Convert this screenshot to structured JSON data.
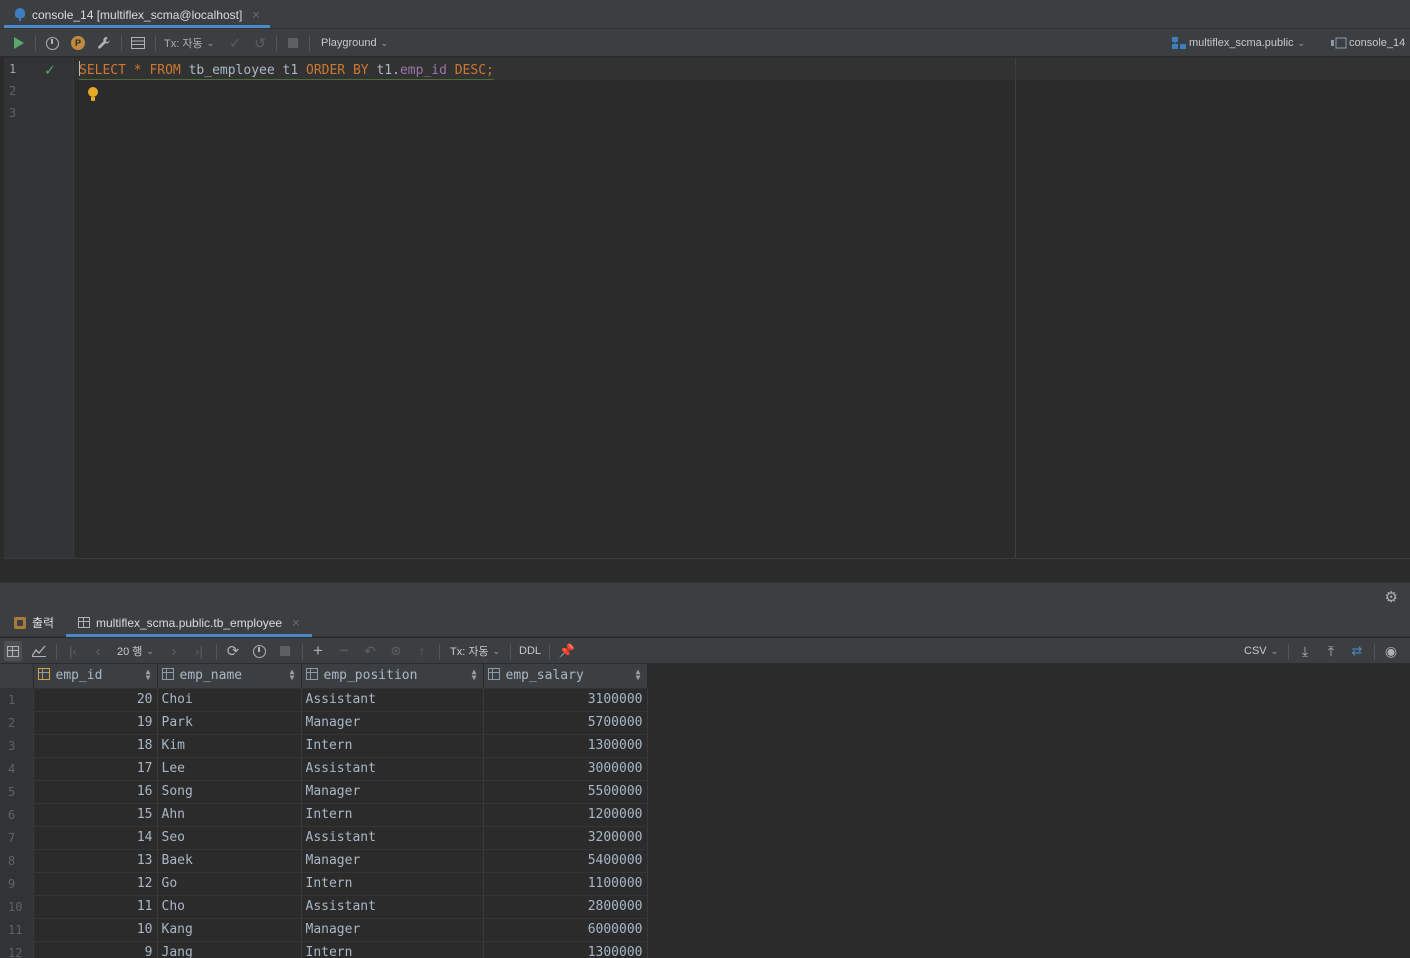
{
  "editor_tab": {
    "title": "console_14 [multiflex_scma@localhost]"
  },
  "toolbar": {
    "tx_label": "Tx: 자동",
    "playground_label": "Playground",
    "schema_label": "multiflex_scma.public",
    "session_label": "console_14"
  },
  "editor": {
    "line_numbers": [
      "1",
      "2",
      "3"
    ],
    "sql": {
      "kw_select": "SELECT",
      "star": "*",
      "kw_from": "FROM",
      "table": "tb_employee t1",
      "kw_order_by": "ORDER BY",
      "alias": "t1.",
      "field": "emp_id",
      "kw_desc": "DESC",
      "semicolon": ";"
    }
  },
  "result_tabs": {
    "output_label": "출력",
    "table_tab_label": "multiflex_scma.public.tb_employee"
  },
  "result_toolbar": {
    "page_size_label": "20 행",
    "tx_label": "Tx: 자동",
    "ddl_label": "DDL",
    "export_format": "CSV"
  },
  "grid": {
    "columns": [
      "emp_id",
      "emp_name",
      "emp_position",
      "emp_salary"
    ],
    "rows": [
      [
        "1",
        "20",
        "Choi",
        "Assistant",
        "3100000"
      ],
      [
        "2",
        "19",
        "Park",
        "Manager",
        "5700000"
      ],
      [
        "3",
        "18",
        "Kim",
        "Intern",
        "1300000"
      ],
      [
        "4",
        "17",
        "Lee",
        "Assistant",
        "3000000"
      ],
      [
        "5",
        "16",
        "Song",
        "Manager",
        "5500000"
      ],
      [
        "6",
        "15",
        "Ahn",
        "Intern",
        "1200000"
      ],
      [
        "7",
        "14",
        "Seo",
        "Assistant",
        "3200000"
      ],
      [
        "8",
        "13",
        "Baek",
        "Manager",
        "5400000"
      ],
      [
        "9",
        "12",
        "Go",
        "Intern",
        "1100000"
      ],
      [
        "10",
        "11",
        "Cho",
        "Assistant",
        "2800000"
      ],
      [
        "11",
        "10",
        "Kang",
        "Manager",
        "6000000"
      ],
      [
        "12",
        "9",
        "Jang",
        "Intern",
        "1300000"
      ]
    ]
  },
  "colors": {
    "keyword": "#cc7832",
    "field": "#9876aa",
    "identifier": "#a9b7c6",
    "run_green": "#59a869",
    "accent_blue": "#4a88c7"
  }
}
